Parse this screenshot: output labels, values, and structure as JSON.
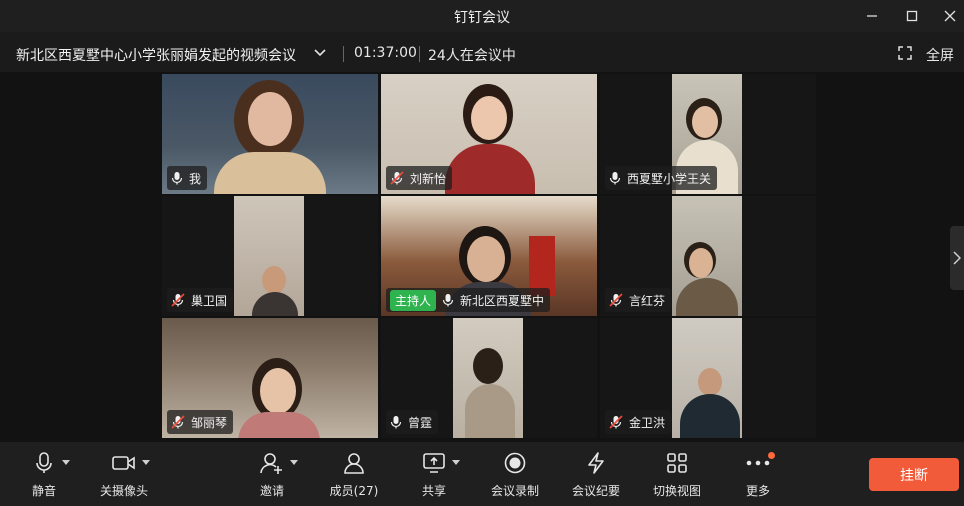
{
  "window": {
    "title": "钉钉会议"
  },
  "meeting": {
    "title": "新北区西夏墅中心小学张丽娟发起的视频会议",
    "duration": "01:37:00",
    "participants_status": "24人在会议中",
    "fullscreen_label": "全屏"
  },
  "participants": [
    {
      "name": "我",
      "mic": "on"
    },
    {
      "name": "刘新怡",
      "mic": "muted"
    },
    {
      "name": "西夏墅小学王关",
      "mic": "on"
    },
    {
      "name": "巢卫国",
      "mic": "muted"
    },
    {
      "name": "新北区西夏墅中",
      "mic": "on",
      "badge": "主持人"
    },
    {
      "name": "言红芬",
      "mic": "muted"
    },
    {
      "name": "邹丽琴",
      "mic": "muted"
    },
    {
      "name": "曾霆",
      "mic": "on"
    },
    {
      "name": "金卫洪",
      "mic": "muted"
    }
  ],
  "toolbar": {
    "mute": "静音",
    "camera_off": "关摄像头",
    "invite": "邀请",
    "members": "成员(27)",
    "share": "共享",
    "record": "会议录制",
    "minutes": "会议纪要",
    "switch_view": "切换视图",
    "more": "更多",
    "hangup": "挂断"
  },
  "colors": {
    "hangup": "#f25b3a",
    "host_badge": "#2fb34f",
    "notification_dot": "#ff6a3d"
  }
}
